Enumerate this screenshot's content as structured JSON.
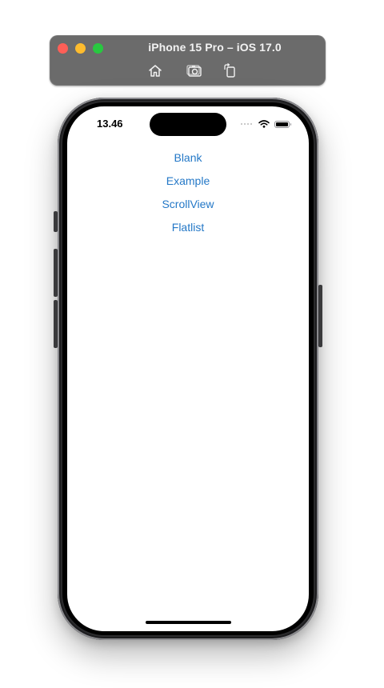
{
  "simulator": {
    "title": "iPhone 15 Pro – iOS 17.0",
    "buttons": [
      {
        "id": "home",
        "icon": "home-icon"
      },
      {
        "id": "screenshot",
        "icon": "camera-icon"
      },
      {
        "id": "rotate",
        "icon": "rotate-icon"
      }
    ]
  },
  "status_bar": {
    "time": "13.46",
    "battery_level": 1.0
  },
  "links": [
    {
      "label": "Blank"
    },
    {
      "label": "Example"
    },
    {
      "label": "ScrollView"
    },
    {
      "label": "Flatlist"
    }
  ],
  "colors": {
    "link": "#2478c7",
    "sim_bar": "#6b6b6b",
    "close": "#ff5f57",
    "minimize": "#febc2e",
    "maximize": "#28c840"
  }
}
